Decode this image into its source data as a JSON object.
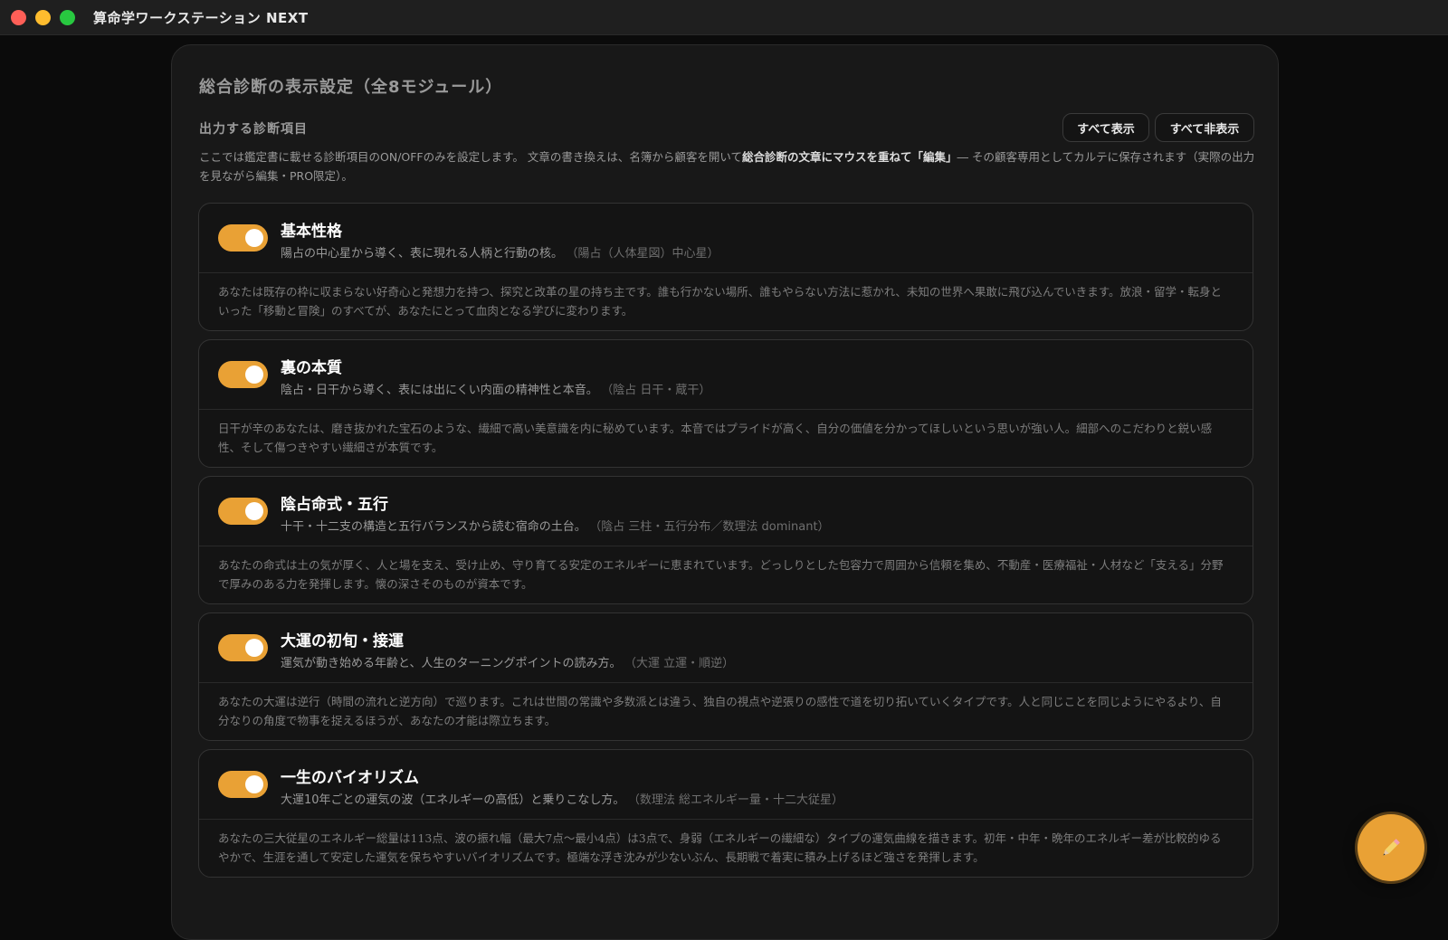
{
  "window": {
    "title": "算命学ワークステーション NEXT"
  },
  "settings": {
    "title": "総合診断の表示設定（全8モジュール）",
    "section_label": "出力する診断項目",
    "show_all": "すべて表示",
    "hide_all": "すべて非表示",
    "description_part1": "ここでは鑑定書に載せる診断項目のON/OFFのみを設定します。 文章の書き換えは、名簿から顧客を開いて",
    "description_bold": "総合診断の文章にマウスを重ねて「編集」",
    "description_part2": "― その顧客専用としてカルテに保存されます（実際の出力を見ながら編集・PRO限定）。"
  },
  "modules": [
    {
      "enabled": true,
      "name": "基本性格",
      "subtitle": "陽占の中心星から導く、表に現れる人柄と行動の核。",
      "source": "（陽占（人体星図）中心星）",
      "body": "あなたは既存の枠に収まらない好奇心と発想力を持つ、探究と改革の星の持ち主です。誰も行かない場所、誰もやらない方法に惹かれ、未知の世界へ果敢に飛び込んでいきます。放浪・留学・転身といった「移動と冒険」のすべてが、あなたにとって血肉となる学びに変わります。"
    },
    {
      "enabled": true,
      "name": "裏の本質",
      "subtitle": "陰占・日干から導く、表には出にくい内面の精神性と本音。",
      "source": "（陰占 日干・蔵干）",
      "body": "日干が辛のあなたは、磨き抜かれた宝石のような、繊細で高い美意識を内に秘めています。本音ではプライドが高く、自分の価値を分かってほしいという思いが強い人。細部へのこだわりと鋭い感性、そして傷つきやすい繊細さが本質です。"
    },
    {
      "enabled": true,
      "name": "陰占命式・五行",
      "subtitle": "十干・十二支の構造と五行バランスから読む宿命の土台。",
      "source": "（陰占 三柱・五行分布／数理法 dominant）",
      "body": "あなたの命式は土の気が厚く、人と場を支え、受け止め、守り育てる安定のエネルギーに恵まれています。どっしりとした包容力で周囲から信頼を集め、不動産・医療福祉・人材など「支える」分野で厚みのある力を発揮します。懐の深さそのものが資本です。"
    },
    {
      "enabled": true,
      "name": "大運の初旬・接運",
      "subtitle": "運気が動き始める年齢と、人生のターニングポイントの読み方。",
      "source": "（大運 立運・順逆）",
      "body": "あなたの大運は逆行（時間の流れと逆方向）で巡ります。これは世間の常識や多数派とは違う、独自の視点や逆張りの感性で道を切り拓いていくタイプです。人と同じことを同じようにやるより、自分なりの角度で物事を捉えるほうが、あなたの才能は際立ちます。"
    },
    {
      "enabled": true,
      "name": "一生のバイオリズム",
      "subtitle": "大運10年ごとの運気の波（エネルギーの高低）と乗りこなし方。",
      "source": "（数理法 総エネルギー量・十二大従星）",
      "body": "あなたの三大従星のエネルギー総量は113点、波の振れ幅（最大7点〜最小4点）は3点で、身弱（エネルギーの繊細な）タイプの運気曲線を描きます。初年・中年・晩年のエネルギー差が比較的ゆるやかで、生涯を通して安定した運気を保ちやすいバイオリズムです。極端な浮き沈みが少ないぶん、長期戦で着実に積み上げるほど強さを発揮します。"
    }
  ],
  "fab": {
    "icon": "pencil-icon"
  },
  "colors": {
    "accent": "#e9a135",
    "background": "#0b0b0b",
    "panel": "#181818",
    "card": "#141414"
  }
}
